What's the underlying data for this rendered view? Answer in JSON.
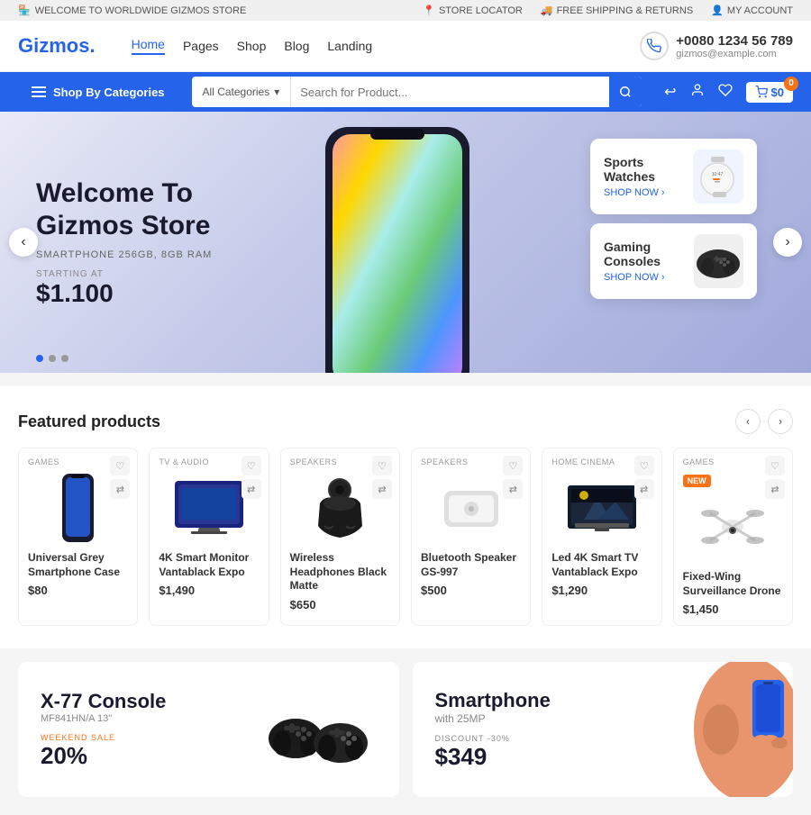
{
  "topbar": {
    "left_text": "WELCOME TO WORLDWIDE GIZMOS STORE",
    "store_locator": "STORE LOCATOR",
    "shipping": "FREE SHIPPING & RETURNS",
    "account": "MY ACCOUNT"
  },
  "header": {
    "logo_text": "Gizmos",
    "logo_dot": ".",
    "nav": [
      {
        "label": "Home",
        "active": true
      },
      {
        "label": "Pages",
        "active": false
      },
      {
        "label": "Shop",
        "active": false
      },
      {
        "label": "Blog",
        "active": false
      },
      {
        "label": "Landing",
        "active": false
      }
    ],
    "phone": "+0080 1234 56 789",
    "email": "gizmos@example.com"
  },
  "navbar": {
    "categories_label": "Shop By Categories",
    "search_placeholder": "Search for Product...",
    "all_categories": "All Categories",
    "cart_amount": "$0"
  },
  "hero": {
    "title_line1": "Welcome To",
    "title_line2": "Gizmos Store",
    "subtitle": "SMARTPHONE 256GB, 8GB RAM",
    "starting_at": "STARTING AT",
    "price": "$1.100",
    "dots": [
      true,
      false,
      false
    ],
    "cards": [
      {
        "title": "Sports Watches",
        "shop_now": "SHOP NOW"
      },
      {
        "title": "Gaming Consoles",
        "shop_now": "SHOP NOW"
      }
    ]
  },
  "featured": {
    "title": "Featured products",
    "products": [
      {
        "category": "GAMES",
        "name": "Universal Grey Smartphone Case",
        "price": "$80",
        "new_badge": false
      },
      {
        "category": "TV & AUDIO",
        "name": "4K Smart Monitor Vantablack Expo",
        "price": "$1,490",
        "new_badge": false
      },
      {
        "category": "SPEAKERS",
        "name": "Wireless Headphones Black Matte",
        "price": "$650",
        "new_badge": false
      },
      {
        "category": "SPEAKERS",
        "name": "Bluetooth Speaker GS-997",
        "price": "$500",
        "new_badge": false
      },
      {
        "category": "HOME CINEMA",
        "name": "Led 4K Smart TV Vantablack Expo",
        "price": "$1,290",
        "new_badge": false
      },
      {
        "category": "GAMES",
        "name": "Fixed-Wing Surveillance Drone",
        "price": "$1,450",
        "new_badge": true,
        "badge_text": "NEW"
      }
    ]
  },
  "promo": [
    {
      "title": "X-77 Console",
      "model": "MF841HN/A 13\"",
      "sale_label": "WEEKEND SALE",
      "price": "20%",
      "type": "percent"
    },
    {
      "title": "Smartphone",
      "subtitle": "with 25MP",
      "discount_label": "DISCOUNT -30%",
      "price": "$349",
      "type": "price"
    }
  ],
  "icons": {
    "search": "🔍",
    "phone": "📞",
    "refresh": "↩",
    "user": "👤",
    "heart": "♡",
    "cart": "🛒",
    "arrow_left": "‹",
    "arrow_right": "›",
    "chevron_right": "›",
    "map_pin": "📍",
    "truck": "🚚",
    "account": "👤",
    "hamburger": "≡",
    "heart_filled": "♡",
    "compare": "⇄"
  }
}
